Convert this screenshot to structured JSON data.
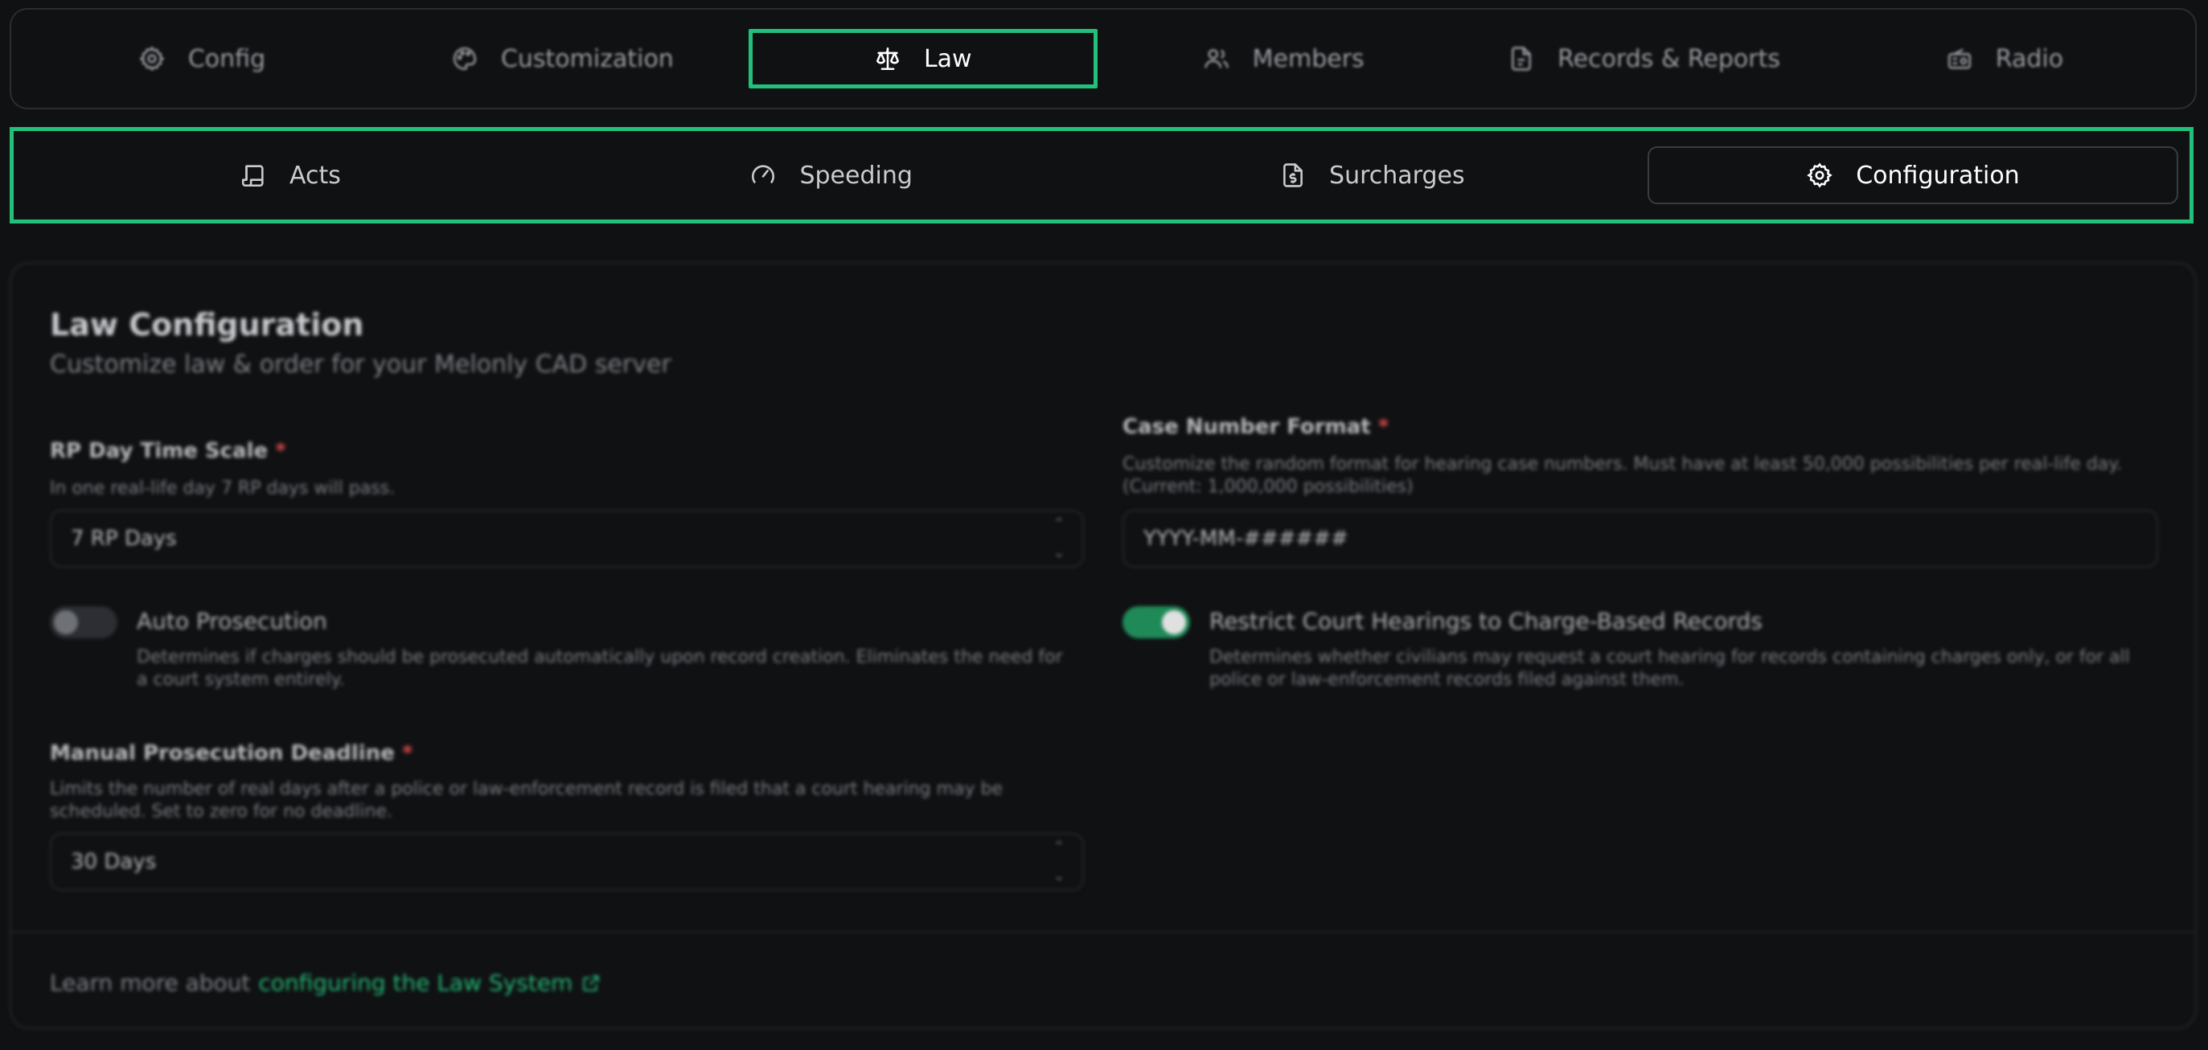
{
  "top_nav": {
    "tabs": [
      {
        "label": "Config",
        "icon": "gear-icon"
      },
      {
        "label": "Customization",
        "icon": "palette-icon"
      },
      {
        "label": "Law",
        "icon": "scale-icon",
        "active": true
      },
      {
        "label": "Members",
        "icon": "users-icon"
      },
      {
        "label": "Records & Reports",
        "icon": "file-icon"
      },
      {
        "label": "Radio",
        "icon": "radio-icon"
      }
    ]
  },
  "sub_nav": {
    "tabs": [
      {
        "label": "Acts",
        "icon": "scroll-icon"
      },
      {
        "label": "Speeding",
        "icon": "gauge-icon"
      },
      {
        "label": "Surcharges",
        "icon": "dollar-file-icon"
      },
      {
        "label": "Configuration",
        "icon": "gear-icon",
        "active": true
      }
    ]
  },
  "card": {
    "title": "Law Configuration",
    "subtitle": "Customize law & order for your Melonly CAD server",
    "rp_day": {
      "label": "RP Day Time Scale",
      "required": "*",
      "help": "In one real-life day 7 RP days will pass.",
      "value": "7 RP Days"
    },
    "case_number": {
      "label": "Case Number Format",
      "required": "*",
      "help_line1": "Customize the random format for hearing case numbers. Must have at least 50,000 possibilities per real-life day.",
      "help_line2": "(Current: 1,000,000 possibilities)",
      "value": "YYYY-MM-######"
    },
    "auto_prosecution": {
      "label": "Auto Prosecution",
      "enabled": false,
      "help_line1": "Determines if charges should be prosecuted automatically upon record creation. Eliminates the need for",
      "help_line2": "a court system entirely."
    },
    "restrict_hearings": {
      "label": "Restrict Court Hearings to Charge-Based Records",
      "enabled": true,
      "help_line1": "Determines whether civilians may request a court hearing for records containing charges only, or for all",
      "help_line2": "police or law-enforcement records filed against them."
    },
    "manual_deadline": {
      "label": "Manual Prosecution Deadline",
      "required": "*",
      "help_line1": "Limits the number of real days after a police or law-enforcement record is filed that a court hearing may be",
      "help_line2": "scheduled. Set to zero for no deadline.",
      "value": "30 Days"
    },
    "footer": {
      "prefix": "Learn more about",
      "link": "configuring the Law System"
    }
  },
  "colors": {
    "accent": "#22c07a",
    "background": "#101113",
    "required": "#d04848"
  }
}
